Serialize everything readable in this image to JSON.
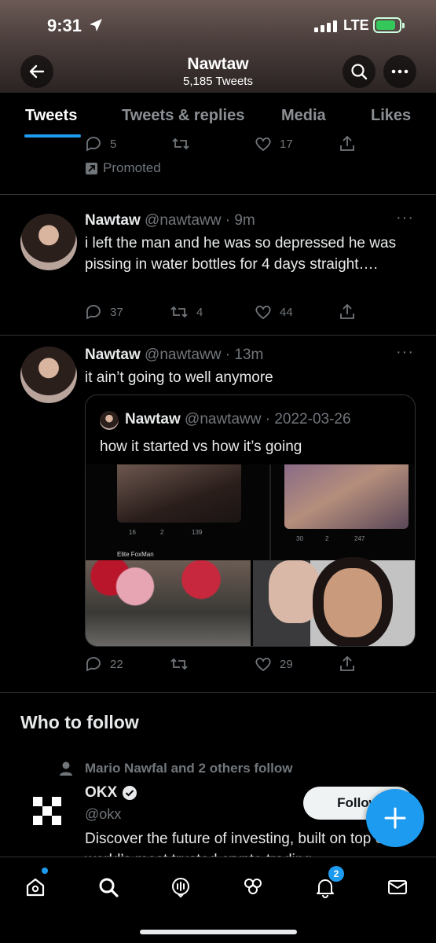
{
  "status_bar": {
    "time": "9:31",
    "network": "LTE"
  },
  "header": {
    "name": "Nawtaw",
    "tweet_count": "5,185 Tweets"
  },
  "tabs": [
    {
      "label": "Tweets",
      "active": true
    },
    {
      "label": "Tweets & replies",
      "active": false
    },
    {
      "label": "Media",
      "active": false
    },
    {
      "label": "Likes",
      "active": false
    }
  ],
  "promoted_tweet": {
    "replies": "5",
    "likes": "17",
    "promoted_label": "Promoted"
  },
  "tweets": [
    {
      "name": "Nawtaw",
      "handle": "@nawtaww",
      "time": "· 9m",
      "text": "i left the man and he was so depressed he was pissing in water bottles for 4 days straight….",
      "replies": "37",
      "retweets": "4",
      "likes": "44"
    },
    {
      "name": "Nawtaw",
      "handle": "@nawtaww",
      "time": "· 13m",
      "text": "it ain’t going to well anymore",
      "replies": "22",
      "retweets": "",
      "likes": "29",
      "quote": {
        "name": "Nawtaw",
        "handle": "@nawtaww",
        "date": "· 2022-03-26",
        "text": "how it started vs how it’s going",
        "inner_left_stats": [
          "16",
          "2",
          "139"
        ],
        "inner_right_stats": [
          "30",
          "2",
          "247"
        ],
        "inner_caption": "Elite FoxMan"
      }
    }
  ],
  "who_to_follow": {
    "title": "Who to follow",
    "social_context": "Mario Nawfal and 2 others follow",
    "account": {
      "name": "OKX",
      "handle": "@okx",
      "bio": "Discover the future of investing, built on top of the world’s most trusted crypto trading",
      "follow_label": "Follow"
    }
  },
  "bottom_nav": {
    "notifications_badge": "2"
  },
  "colors": {
    "accent": "#1d9bf0",
    "background": "#000000",
    "muted": "#71767b"
  }
}
